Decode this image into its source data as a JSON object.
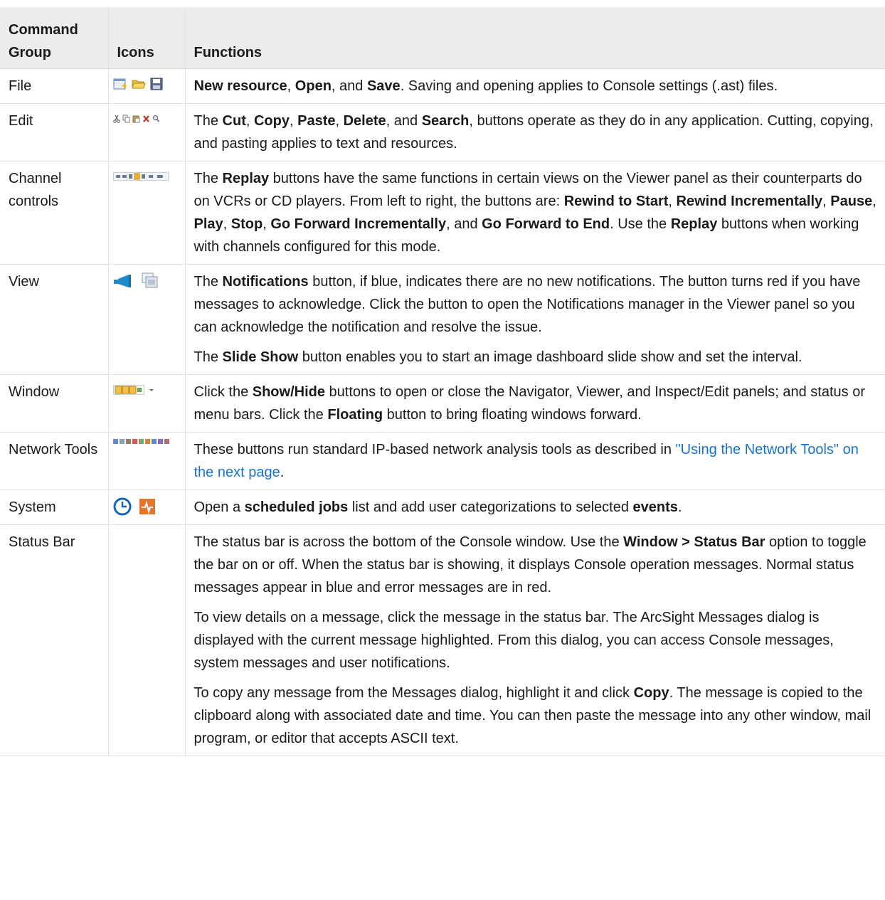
{
  "header": {
    "col1": "Command Group",
    "col2": "Icons",
    "col3": "Functions"
  },
  "rows": {
    "file": {
      "group": "File",
      "icons": [
        "new-resource-icon",
        "open-folder-icon",
        "save-disk-icon"
      ],
      "p1": [
        {
          "t": "New resource",
          "b": true
        },
        {
          "t": ", "
        },
        {
          "t": "Open",
          "b": true
        },
        {
          "t": ", and "
        },
        {
          "t": "Save",
          "b": true
        },
        {
          "t": ". Saving and opening applies to Console settings (.ast) files."
        }
      ]
    },
    "edit": {
      "group": "Edit",
      "icons": [
        "cut-icon",
        "copy-icon",
        "paste-icon",
        "delete-icon",
        "search-icon"
      ],
      "p1": [
        {
          "t": "The "
        },
        {
          "t": "Cut",
          "b": true
        },
        {
          "t": ", "
        },
        {
          "t": "Copy",
          "b": true
        },
        {
          "t": ", "
        },
        {
          "t": "Paste",
          "b": true
        },
        {
          "t": ", "
        },
        {
          "t": "Delete",
          "b": true
        },
        {
          "t": ", and "
        },
        {
          "t": "Search",
          "b": true
        },
        {
          "t": ", buttons operate as they do in any application. Cutting, copying, and pasting applies to text and resources."
        }
      ]
    },
    "channel": {
      "group": "Channel controls",
      "icons": [
        "replay-controls-icon"
      ],
      "p1": [
        {
          "t": "The "
        },
        {
          "t": "Replay",
          "b": true
        },
        {
          "t": " buttons have the same functions in certain views on the Viewer panel as their counterparts do on VCRs or CD players. From left to right, the buttons are: "
        },
        {
          "t": "Rewind to Start",
          "b": true
        },
        {
          "t": ", "
        },
        {
          "t": "Rewind Incrementally",
          "b": true
        },
        {
          "t": ", "
        },
        {
          "t": "Pause",
          "b": true
        },
        {
          "t": ", "
        },
        {
          "t": "Play",
          "b": true
        },
        {
          "t": ", "
        },
        {
          "t": "Stop",
          "b": true
        },
        {
          "t": ", "
        },
        {
          "t": "Go Forward Incrementally",
          "b": true
        },
        {
          "t": ", and "
        },
        {
          "t": "Go Forward to End",
          "b": true
        },
        {
          "t": ". Use the "
        },
        {
          "t": "Replay",
          "b": true
        },
        {
          "t": " buttons when working with channels configured for this mode."
        }
      ]
    },
    "view": {
      "group": "View",
      "icons": [
        "notifications-megaphone-icon",
        "slide-show-icon"
      ],
      "p1": [
        {
          "t": "The "
        },
        {
          "t": "Notifications",
          "b": true
        },
        {
          "t": " button, if blue, indicates there are no new notifications. The button turns red if you have messages to acknowledge. Click the button to open the Notifications manager in the Viewer panel so you can acknowledge the notification and resolve the issue."
        }
      ],
      "p2": [
        {
          "t": "The "
        },
        {
          "t": "Slide Show",
          "b": true
        },
        {
          "t": " button enables you to start an image dashboard slide show and set the interval."
        }
      ]
    },
    "window": {
      "group": "Window",
      "icons": [
        "show-hide-panels-icon",
        "floating-windows-icon"
      ],
      "p1": [
        {
          "t": "Click the "
        },
        {
          "t": "Show/Hide",
          "b": true
        },
        {
          "t": " buttons to open or close the Navigator, Viewer, and Inspect/Edit panels; and status or menu bars. Click the "
        },
        {
          "t": "Floating",
          "b": true
        },
        {
          "t": " button to bring floating windows forward."
        }
      ]
    },
    "network": {
      "group": "Network Tools",
      "icons": [
        "network-tools-icon"
      ],
      "p1": [
        {
          "t": "These buttons run standard IP-based network analysis tools as described in "
        },
        {
          "t": "\"Using the Network Tools\" on the next page",
          "link": true
        },
        {
          "t": "."
        }
      ]
    },
    "system": {
      "group": "System",
      "icons": [
        "scheduled-jobs-clock-icon",
        "categorize-events-icon"
      ],
      "p1": [
        {
          "t": "Open a "
        },
        {
          "t": "scheduled jobs",
          "b": true
        },
        {
          "t": " list and add user categorizations to selected "
        },
        {
          "t": "events",
          "b": true
        },
        {
          "t": "."
        }
      ]
    },
    "status": {
      "group": "Status Bar",
      "icons": [],
      "p1": [
        {
          "t": "The status bar is across the bottom of the Console window. Use the "
        },
        {
          "t": "Window > Status Bar",
          "b": true
        },
        {
          "t": " option to toggle the bar on or off. When the status bar is showing, it displays Console operation messages. Normal status messages appear in blue and error messages are in red."
        }
      ],
      "p2": [
        {
          "t": "To view details on a message, click the message in the status bar. The ArcSight Messages dialog is displayed with the current message highlighted. From this dialog, you can access Console messages, system messages and user notifications."
        }
      ],
      "p3": [
        {
          "t": "To copy any message from the Messages dialog, highlight it and click "
        },
        {
          "t": "Copy",
          "b": true
        },
        {
          "t": ". The message is copied to the clipboard along with associated date and time. You can then paste the message into any other window, mail program, or editor that accepts ASCII text."
        }
      ]
    }
  },
  "colors": {
    "link": "#1a73c8",
    "header_bg": "#ececec",
    "notify_blue": "#1f8ac9",
    "clock_blue": "#1565c0",
    "categorize_orange": "#e8742a"
  }
}
